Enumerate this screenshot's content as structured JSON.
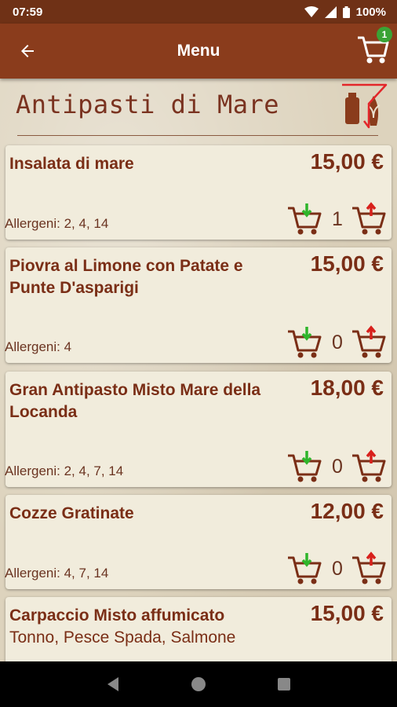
{
  "status": {
    "time": "07:59",
    "battery": "100%"
  },
  "app_bar": {
    "title": "Menu",
    "cart_count": "1"
  },
  "section": {
    "title": "Antipasti di Mare"
  },
  "items": [
    {
      "name": "Insalata di mare",
      "description": "",
      "price": "15,00 €",
      "allergens": "Allergeni: 2, 4, 14",
      "qty": "1"
    },
    {
      "name": "Piovra al Limone con Patate e Punte D'asparigi",
      "description": "",
      "price": "15,00 €",
      "allergens": "Allergeni: 4",
      "qty": "0"
    },
    {
      "name": "Gran Antipasto Misto Mare della Locanda",
      "description": "",
      "price": "18,00 €",
      "allergens": "Allergeni: 2, 4, 7, 14",
      "qty": "0"
    },
    {
      "name": "Cozze Gratinate",
      "description": "",
      "price": "12,00 €",
      "allergens": "Allergeni: 4, 7, 14",
      "qty": "0"
    },
    {
      "name": "Carpaccio Misto affumicato",
      "description": "Tonno, Pesce Spada, Salmone",
      "price": "15,00 €",
      "allergens": "",
      "qty": ""
    }
  ],
  "icons": {
    "back": "arrow-left-icon",
    "cart": "shopping-cart-icon",
    "filter": "allergen-filter-icon",
    "remove": "cart-remove-icon",
    "add": "cart-add-icon"
  },
  "colors": {
    "app_bar": "#8a3c1c",
    "status_bar": "#6f3116",
    "text": "#7a2e16",
    "badge": "#3aa335",
    "add_arrow": "#d8201c",
    "remove_arrow": "#2fb52b"
  }
}
